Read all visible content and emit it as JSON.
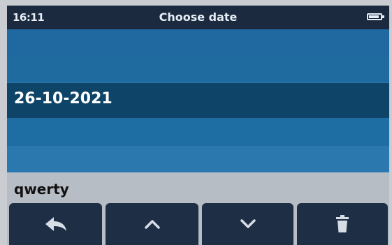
{
  "status": {
    "time": "16:11",
    "title": "Choose date",
    "battery_icon": "battery-icon"
  },
  "picker": {
    "selected_value": "26-10-2021"
  },
  "input_mode": {
    "label": "qwerty"
  },
  "softkeys": [
    {
      "icon": "back-arrow-icon"
    },
    {
      "icon": "chevron-up-icon"
    },
    {
      "icon": "chevron-down-icon"
    },
    {
      "icon": "trash-icon"
    }
  ],
  "colors": {
    "status_bar": "#1b2a3f",
    "picker_bg": "#2f7fb6",
    "selected_row": "#0d4468",
    "softkey_bg": "#1e2e45",
    "keyboard_bg": "#b7bdc4"
  }
}
